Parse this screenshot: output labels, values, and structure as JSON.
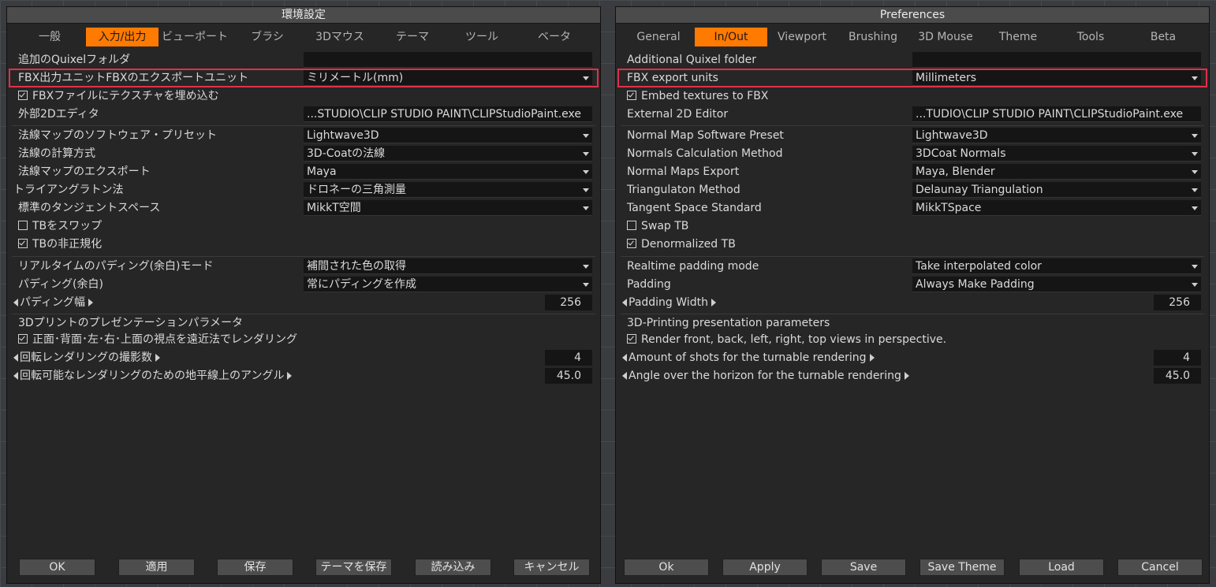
{
  "colors": {
    "accent": "#ff7a00",
    "highlight": "#e0304a",
    "panel": "#262626"
  },
  "ja": {
    "title": "環境設定",
    "tabs": [
      "一般",
      "入力/出力",
      "ビューポート",
      "ブラシ",
      "3Dマウス",
      "テーマ",
      "ツール",
      "ベータ"
    ],
    "active_tab": "入力/出力",
    "quixel_label": "追加のQuixelフォルダ",
    "quixel_value": "",
    "fbx_units_label": "FBX出力ユニットFBXのエクスポートユニット",
    "fbx_units_value": "ミリメートル(mm)",
    "embed_label": "FBXファイルにテクスチャを埋め込む",
    "editor_label": "外部2Dエディタ",
    "editor_value": "...STUDIO\\CLIP STUDIO PAINT\\CLIPStudioPaint.exe",
    "nm_preset_label": "法線マップのソフトウェア・プリセット",
    "nm_preset_value": "Lightwave3D",
    "calc_label": "法線の計算方式",
    "calc_value": "3D-Coatの法線",
    "nm_export_label": "法線マップのエクスポート",
    "nm_export_value": "Maya",
    "tri_label": "トライアングラトン法",
    "tri_value": "ドロネーの三角測量",
    "tangent_label": "標準のタンジェントスペース",
    "tangent_value": "MikkT空間",
    "swap_label": "TBをスワップ",
    "denorm_label": "TBの非正規化",
    "rt_pad_label": "リアルタイムのパディング(余白)モード",
    "rt_pad_value": "補間された色の取得",
    "pad_label": "パディング(余白)",
    "pad_value": "常にパディングを作成",
    "pad_width_label": "パディング幅",
    "pad_width_value": "256",
    "print_header": "3Dプリントのプレゼンテーションパラメータ",
    "render_label": "正面･背面･左･右･上面の視点を遠近法でレンダリング",
    "shots_label": "回転レンダリングの撮影数",
    "shots_value": "4",
    "angle_label": "回転可能なレンダリングのための地平線上のアングル",
    "angle_value": "45.0",
    "buttons": [
      "OK",
      "適用",
      "保存",
      "テーマを保存",
      "読み込み",
      "キャンセル"
    ]
  },
  "en": {
    "title": "Preferences",
    "tabs": [
      "General",
      "In/Out",
      "Viewport",
      "Brushing",
      "3D Mouse",
      "Theme",
      "Tools",
      "Beta"
    ],
    "active_tab": "In/Out",
    "quixel_label": "Additional Quixel folder",
    "quixel_value": "",
    "fbx_units_label": "FBX export units",
    "fbx_units_value": "Millimeters",
    "embed_label": "Embed textures to FBX",
    "editor_label": "External 2D Editor",
    "editor_value": "...TUDIO\\CLIP STUDIO PAINT\\CLIPStudioPaint.exe",
    "nm_preset_label": "Normal Map Software Preset",
    "nm_preset_value": "Lightwave3D",
    "calc_label": "Normals Calculation Method",
    "calc_value": "3DCoat Normals",
    "nm_export_label": "Normal Maps Export",
    "nm_export_value": "Maya, Blender",
    "tri_label": "Triangulaton Method",
    "tri_value": "Delaunay Triangulation",
    "tangent_label": "Tangent Space Standard",
    "tangent_value": "MikkTSpace",
    "swap_label": "Swap TB",
    "denorm_label": "Denormalized TB",
    "rt_pad_label": "Realtime padding mode",
    "rt_pad_value": "Take interpolated color",
    "pad_label": "Padding",
    "pad_value": "Always Make Padding",
    "pad_width_label": "Padding Width",
    "pad_width_value": "256",
    "print_header": "3D-Printing presentation parameters",
    "render_label": "Render front, back, left, right, top views in perspective.",
    "shots_label": "Amount of shots for the turnable rendering",
    "shots_value": "4",
    "angle_label": "Angle over the horizon for the turnable rendering",
    "angle_value": "45.0",
    "buttons": [
      "Ok",
      "Apply",
      "Save",
      "Save Theme",
      "Load",
      "Cancel"
    ]
  }
}
